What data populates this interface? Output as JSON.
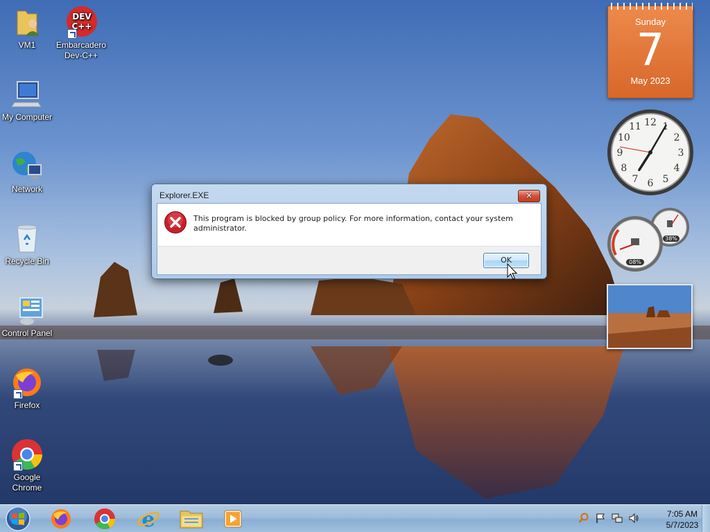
{
  "desktop_icons": [
    {
      "label": "VM1",
      "icon": "user-folder-icon"
    },
    {
      "label": "Embarcadero Dev-C++",
      "icon": "devcpp-icon",
      "shortcut": true
    },
    {
      "label": "My Computer",
      "icon": "computer-icon"
    },
    {
      "label": "Network",
      "icon": "network-icon"
    },
    {
      "label": "Recycle Bin",
      "icon": "recycle-bin-icon"
    },
    {
      "label": "Control Panel",
      "icon": "control-panel-icon"
    },
    {
      "label": "Firefox",
      "icon": "firefox-icon",
      "shortcut": true
    },
    {
      "label": "Google Chrome",
      "icon": "chrome-icon",
      "shortcut": true
    }
  ],
  "devcpp_badge": {
    "line1": "DEV",
    "line2": "C++"
  },
  "calendar": {
    "day_name": "Sunday",
    "day_number": "7",
    "month_year": "May 2023"
  },
  "clock_gadget": {
    "hour": 7,
    "minute": 5,
    "numerals": [
      "12",
      "1",
      "2",
      "3",
      "4",
      "5",
      "6",
      "7",
      "8",
      "9",
      "10",
      "11"
    ]
  },
  "cpu_meter": {
    "cpu_percent": "08%",
    "memory_percent": "38%"
  },
  "dialog": {
    "title": "Explorer.EXE",
    "close_label": "✕",
    "message": "This program is blocked by group policy. For more information, contact your system administrator.",
    "ok_label": "OK"
  },
  "taskbar": {
    "pinned": [
      "firefox-icon",
      "chrome-icon",
      "internet-explorer-icon",
      "file-explorer-icon",
      "media-player-icon"
    ],
    "tray_icons": [
      "search-icon",
      "action-center-flag-icon",
      "network-icon",
      "volume-icon"
    ],
    "time": "7:05 AM",
    "date": "5/7/2023"
  },
  "colors": {
    "calendar_bg": "#e07a3c",
    "error_red": "#c8202a",
    "dialog_frame": "#b9d1ea"
  }
}
